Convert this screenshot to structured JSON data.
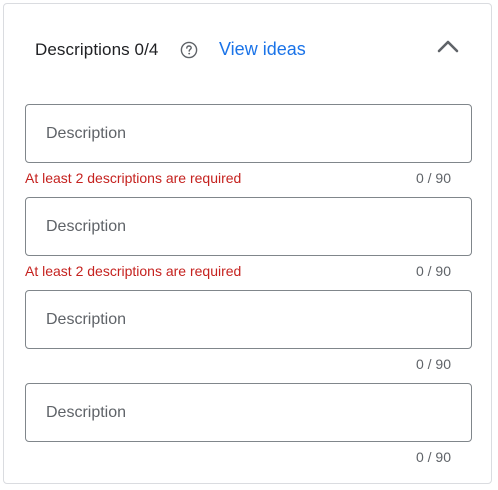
{
  "header": {
    "title": "Descriptions 0/4",
    "help_icon": "help-circle-icon",
    "view_ideas_label": "View ideas",
    "collapse_icon": "chevron-up-icon"
  },
  "fields": [
    {
      "placeholder": "Description",
      "value": "",
      "error": "At least 2 descriptions are required",
      "counter": "0 / 90"
    },
    {
      "placeholder": "Description",
      "value": "",
      "error": "At least 2 descriptions are required",
      "counter": "0 / 90"
    },
    {
      "placeholder": "Description",
      "value": "",
      "error": "",
      "counter": "0 / 90"
    },
    {
      "placeholder": "Description",
      "value": "",
      "error": "",
      "counter": "0 / 90"
    }
  ],
  "colors": {
    "link": "#1a73e8",
    "error": "#c5221f",
    "border": "#80868b",
    "muted": "#5f6368"
  }
}
